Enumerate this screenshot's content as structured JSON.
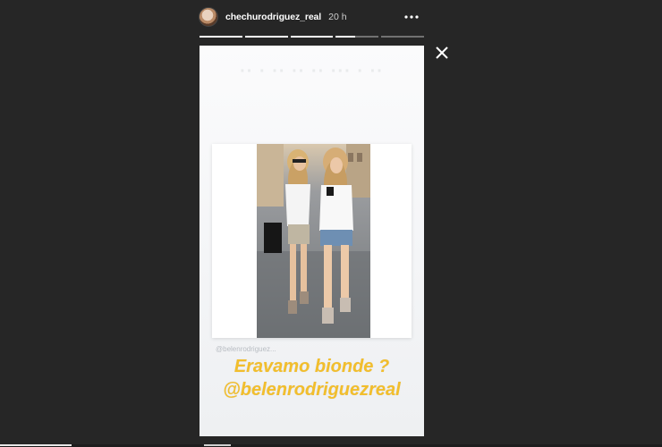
{
  "header": {
    "username": "chechurodriguez_real",
    "timestamp": "20 h",
    "avatar_icon": "profile-photo",
    "more_icon": "more-horizontal-icon"
  },
  "progress": {
    "segments": [
      1,
      1,
      1,
      0.45,
      0
    ]
  },
  "controls": {
    "close_icon": "close-icon"
  },
  "story": {
    "ghost_text": "·· · ·· ·· ·· ··· · ··",
    "small_mention": "@belenrodriguez...",
    "caption_line1": "Eravamo bionde ?",
    "caption_line2": "@belenrodriguezreal"
  },
  "colors": {
    "background": "#262626",
    "caption": "#f2be2c",
    "story_bg": "#f4f5f7"
  }
}
